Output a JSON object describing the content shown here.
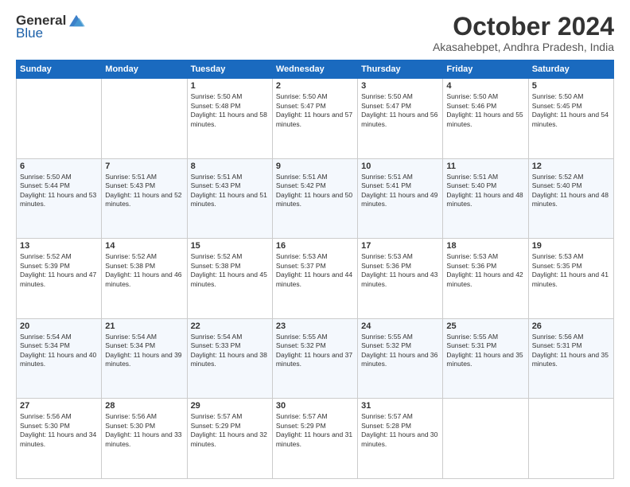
{
  "logo": {
    "general": "General",
    "blue": "Blue"
  },
  "title": "October 2024",
  "location": "Akasahebpet, Andhra Pradesh, India",
  "days_header": [
    "Sunday",
    "Monday",
    "Tuesday",
    "Wednesday",
    "Thursday",
    "Friday",
    "Saturday"
  ],
  "weeks": [
    [
      {
        "day": "",
        "sunrise": "",
        "sunset": "",
        "daylight": ""
      },
      {
        "day": "",
        "sunrise": "",
        "sunset": "",
        "daylight": ""
      },
      {
        "day": "1",
        "sunrise": "Sunrise: 5:50 AM",
        "sunset": "Sunset: 5:48 PM",
        "daylight": "Daylight: 11 hours and 58 minutes."
      },
      {
        "day": "2",
        "sunrise": "Sunrise: 5:50 AM",
        "sunset": "Sunset: 5:47 PM",
        "daylight": "Daylight: 11 hours and 57 minutes."
      },
      {
        "day": "3",
        "sunrise": "Sunrise: 5:50 AM",
        "sunset": "Sunset: 5:47 PM",
        "daylight": "Daylight: 11 hours and 56 minutes."
      },
      {
        "day": "4",
        "sunrise": "Sunrise: 5:50 AM",
        "sunset": "Sunset: 5:46 PM",
        "daylight": "Daylight: 11 hours and 55 minutes."
      },
      {
        "day": "5",
        "sunrise": "Sunrise: 5:50 AM",
        "sunset": "Sunset: 5:45 PM",
        "daylight": "Daylight: 11 hours and 54 minutes."
      }
    ],
    [
      {
        "day": "6",
        "sunrise": "Sunrise: 5:50 AM",
        "sunset": "Sunset: 5:44 PM",
        "daylight": "Daylight: 11 hours and 53 minutes."
      },
      {
        "day": "7",
        "sunrise": "Sunrise: 5:51 AM",
        "sunset": "Sunset: 5:43 PM",
        "daylight": "Daylight: 11 hours and 52 minutes."
      },
      {
        "day": "8",
        "sunrise": "Sunrise: 5:51 AM",
        "sunset": "Sunset: 5:43 PM",
        "daylight": "Daylight: 11 hours and 51 minutes."
      },
      {
        "day": "9",
        "sunrise": "Sunrise: 5:51 AM",
        "sunset": "Sunset: 5:42 PM",
        "daylight": "Daylight: 11 hours and 50 minutes."
      },
      {
        "day": "10",
        "sunrise": "Sunrise: 5:51 AM",
        "sunset": "Sunset: 5:41 PM",
        "daylight": "Daylight: 11 hours and 49 minutes."
      },
      {
        "day": "11",
        "sunrise": "Sunrise: 5:51 AM",
        "sunset": "Sunset: 5:40 PM",
        "daylight": "Daylight: 11 hours and 48 minutes."
      },
      {
        "day": "12",
        "sunrise": "Sunrise: 5:52 AM",
        "sunset": "Sunset: 5:40 PM",
        "daylight": "Daylight: 11 hours and 48 minutes."
      }
    ],
    [
      {
        "day": "13",
        "sunrise": "Sunrise: 5:52 AM",
        "sunset": "Sunset: 5:39 PM",
        "daylight": "Daylight: 11 hours and 47 minutes."
      },
      {
        "day": "14",
        "sunrise": "Sunrise: 5:52 AM",
        "sunset": "Sunset: 5:38 PM",
        "daylight": "Daylight: 11 hours and 46 minutes."
      },
      {
        "day": "15",
        "sunrise": "Sunrise: 5:52 AM",
        "sunset": "Sunset: 5:38 PM",
        "daylight": "Daylight: 11 hours and 45 minutes."
      },
      {
        "day": "16",
        "sunrise": "Sunrise: 5:53 AM",
        "sunset": "Sunset: 5:37 PM",
        "daylight": "Daylight: 11 hours and 44 minutes."
      },
      {
        "day": "17",
        "sunrise": "Sunrise: 5:53 AM",
        "sunset": "Sunset: 5:36 PM",
        "daylight": "Daylight: 11 hours and 43 minutes."
      },
      {
        "day": "18",
        "sunrise": "Sunrise: 5:53 AM",
        "sunset": "Sunset: 5:36 PM",
        "daylight": "Daylight: 11 hours and 42 minutes."
      },
      {
        "day": "19",
        "sunrise": "Sunrise: 5:53 AM",
        "sunset": "Sunset: 5:35 PM",
        "daylight": "Daylight: 11 hours and 41 minutes."
      }
    ],
    [
      {
        "day": "20",
        "sunrise": "Sunrise: 5:54 AM",
        "sunset": "Sunset: 5:34 PM",
        "daylight": "Daylight: 11 hours and 40 minutes."
      },
      {
        "day": "21",
        "sunrise": "Sunrise: 5:54 AM",
        "sunset": "Sunset: 5:34 PM",
        "daylight": "Daylight: 11 hours and 39 minutes."
      },
      {
        "day": "22",
        "sunrise": "Sunrise: 5:54 AM",
        "sunset": "Sunset: 5:33 PM",
        "daylight": "Daylight: 11 hours and 38 minutes."
      },
      {
        "day": "23",
        "sunrise": "Sunrise: 5:55 AM",
        "sunset": "Sunset: 5:32 PM",
        "daylight": "Daylight: 11 hours and 37 minutes."
      },
      {
        "day": "24",
        "sunrise": "Sunrise: 5:55 AM",
        "sunset": "Sunset: 5:32 PM",
        "daylight": "Daylight: 11 hours and 36 minutes."
      },
      {
        "day": "25",
        "sunrise": "Sunrise: 5:55 AM",
        "sunset": "Sunset: 5:31 PM",
        "daylight": "Daylight: 11 hours and 35 minutes."
      },
      {
        "day": "26",
        "sunrise": "Sunrise: 5:56 AM",
        "sunset": "Sunset: 5:31 PM",
        "daylight": "Daylight: 11 hours and 35 minutes."
      }
    ],
    [
      {
        "day": "27",
        "sunrise": "Sunrise: 5:56 AM",
        "sunset": "Sunset: 5:30 PM",
        "daylight": "Daylight: 11 hours and 34 minutes."
      },
      {
        "day": "28",
        "sunrise": "Sunrise: 5:56 AM",
        "sunset": "Sunset: 5:30 PM",
        "daylight": "Daylight: 11 hours and 33 minutes."
      },
      {
        "day": "29",
        "sunrise": "Sunrise: 5:57 AM",
        "sunset": "Sunset: 5:29 PM",
        "daylight": "Daylight: 11 hours and 32 minutes."
      },
      {
        "day": "30",
        "sunrise": "Sunrise: 5:57 AM",
        "sunset": "Sunset: 5:29 PM",
        "daylight": "Daylight: 11 hours and 31 minutes."
      },
      {
        "day": "31",
        "sunrise": "Sunrise: 5:57 AM",
        "sunset": "Sunset: 5:28 PM",
        "daylight": "Daylight: 11 hours and 30 minutes."
      },
      {
        "day": "",
        "sunrise": "",
        "sunset": "",
        "daylight": ""
      },
      {
        "day": "",
        "sunrise": "",
        "sunset": "",
        "daylight": ""
      }
    ]
  ]
}
